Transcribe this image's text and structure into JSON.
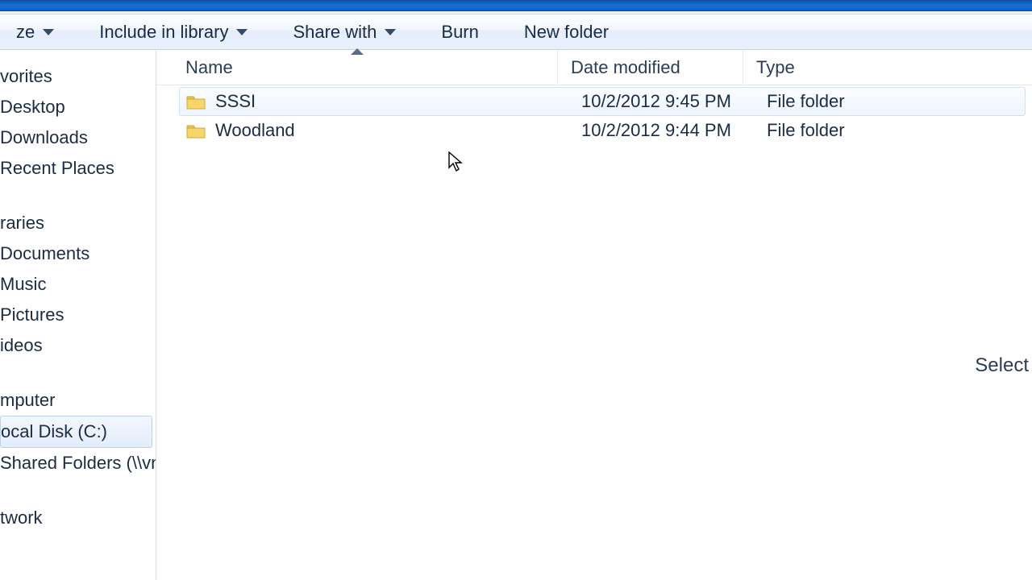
{
  "toolbar": {
    "organize": "ze",
    "include": "Include in library",
    "share": "Share with",
    "burn": "Burn",
    "newfolder": "New folder"
  },
  "nav": {
    "favorites": "vorites",
    "desktop": "Desktop",
    "downloads": "Downloads",
    "recent": "Recent Places",
    "libraries": "raries",
    "documents": "Documents",
    "music": "Music",
    "pictures": "Pictures",
    "videos": "ideos",
    "computer": "mputer",
    "localdisk": "ocal Disk (C:)",
    "shared": "Shared Folders (\\\\vn",
    "network": "twork"
  },
  "columns": {
    "name": "Name",
    "date": "Date modified",
    "type": "Type"
  },
  "rows": [
    {
      "name": "SSSI",
      "date": "10/2/2012 9:45 PM",
      "type": "File folder"
    },
    {
      "name": "Woodland",
      "date": "10/2/2012 9:44 PM",
      "type": "File folder"
    }
  ],
  "status": {
    "select_hint": "Select"
  }
}
